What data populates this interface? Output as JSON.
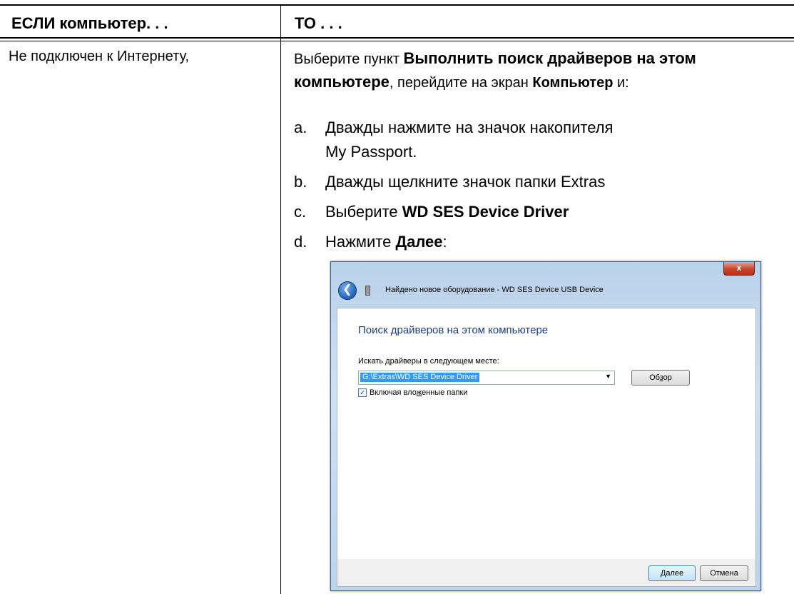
{
  "table": {
    "header_if": "ЕСЛИ компьютер. . .",
    "header_then": "ТО . . .",
    "condition": "Не подключен к Интернету,"
  },
  "instructions": {
    "intro_1": "Выберите пункт ",
    "intro_bold_1": "Выполнить поиск драйверов на этом компьютере",
    "intro_2": ", перейдите на экран ",
    "intro_bold_2": "Компьютер",
    "intro_3": " и:",
    "steps": [
      {
        "letter": "a.",
        "text": "Дважды нажмите на значок накопителя My Passport."
      },
      {
        "letter": "b.",
        "text": "Дважды щелкните значок папки Extras"
      },
      {
        "letter": "c.",
        "text_pre": "Выберите ",
        "text_bold": "WD SES Device Driver"
      },
      {
        "letter": "d.",
        "text_pre": "Нажмите ",
        "text_bold": "Далее",
        "text_post": ":"
      }
    ]
  },
  "wizard": {
    "close_glyph": "x",
    "title": "Найдено новое оборудование - WD SES Device USB Device",
    "heading": "Поиск драйверов на этом компьютере",
    "search_label": "Искать драйверы в следующем месте:",
    "path_value": "G:\\Extras\\WD SES Device Driver",
    "browse_label_pre": "Об",
    "browse_label_ak": "з",
    "browse_label_post": "ор",
    "include_subfolders_pre": "Включая вло",
    "include_subfolders_ak": "ж",
    "include_subfolders_post": "енные папки",
    "include_subfolders_checked": true,
    "next_label_ak": "Д",
    "next_label_post": "алее",
    "cancel_label": "Отмена"
  }
}
